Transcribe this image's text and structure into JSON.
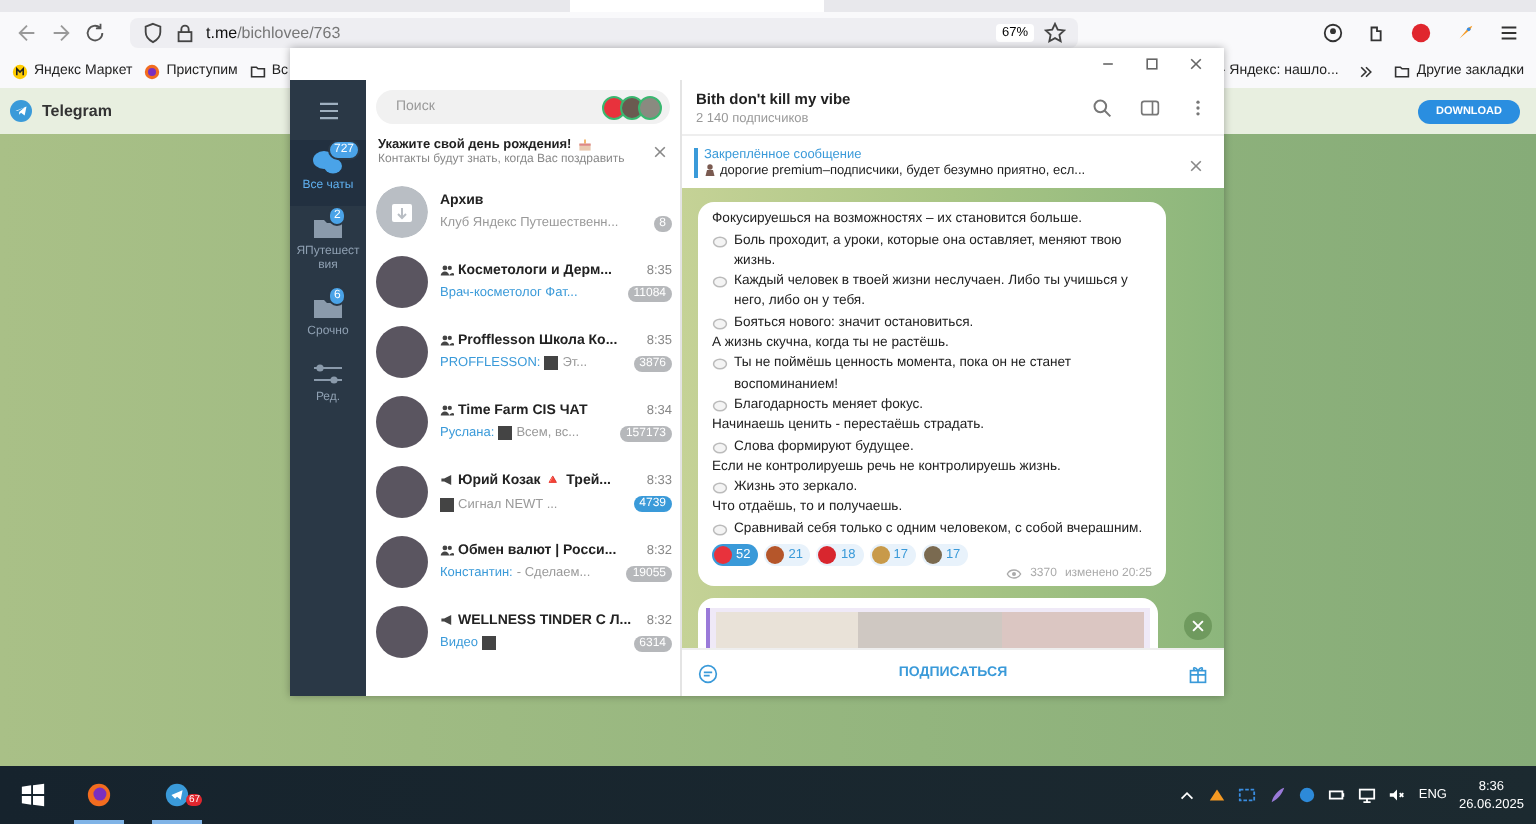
{
  "browser": {
    "url_host": "t.me",
    "url_path": "/bichlovee/763",
    "zoom": "67%",
    "bookmarks_left": [
      {
        "label": "Яндекс Маркет",
        "kind": "market"
      },
      {
        "label": "Приступим",
        "kind": "fox"
      },
      {
        "label": "Вс",
        "kind": "folder"
      }
    ],
    "bookmarks_right": [
      {
        "label": "- Яндекс: нашло...",
        "kind": "plain"
      },
      {
        "label": "Другие закладки",
        "kind": "folder"
      }
    ]
  },
  "web_header": {
    "title": "Telegram",
    "button": "DOWNLOAD"
  },
  "sidebar": {
    "folders": [
      {
        "label": "Все чаты",
        "badge": "727",
        "selected": true,
        "kind": "chats"
      },
      {
        "label": "ЯПутешествия",
        "badge": "2",
        "selected": false,
        "kind": "folder"
      },
      {
        "label": "Срочно",
        "badge": "6",
        "selected": false,
        "kind": "folder"
      },
      {
        "label": "Ред.",
        "selected": false,
        "kind": "edit"
      }
    ]
  },
  "search": {
    "placeholder": "Поиск"
  },
  "banner": {
    "title": "Укажите свой день рождения!",
    "text": "Контакты будут знать, когда Вас поздравить"
  },
  "chats": [
    {
      "kind": "archive",
      "name": "Архив",
      "preview": "Клуб Яндекс Путешественн...",
      "badge": "8",
      "muted": true
    },
    {
      "kind": "group",
      "name": "Косметологи и Дерм...",
      "time": "8:35",
      "accent": "Врач-косметолог Фат...",
      "badge": "11084",
      "muted": true
    },
    {
      "kind": "group",
      "name": "Profflesson Школа Ко...",
      "time": "8:35",
      "accent": "PROFFLESSON:",
      "media": true,
      "preview": "Эт...",
      "badge": "3876",
      "muted": true
    },
    {
      "kind": "group",
      "name": "Time Farm CIS ЧАТ",
      "time": "8:34",
      "accent": "Руслана:",
      "media": true,
      "preview": "Всем, вс...",
      "badge": "157173",
      "muted": true
    },
    {
      "kind": "channel",
      "name": "Юрий Козак 🔺 Трей...",
      "time": "8:33",
      "media": true,
      "preview": "Сигнал NEWT ...",
      "badge": "4739",
      "muted": false
    },
    {
      "kind": "group",
      "name": "Обмен валют | Росси...",
      "time": "8:32",
      "accent": "Константин:",
      "preview": "- Сделаем...",
      "badge": "19055",
      "muted": true
    },
    {
      "kind": "channel",
      "name": "WELLNESS TINDER С Л...",
      "time": "8:32",
      "media": true,
      "accent": "Видео",
      "badge": "6314",
      "muted": true
    }
  ],
  "chat": {
    "title": "Bith don't kill my vibe",
    "subtitle": "2 140 подписчиков",
    "pinned": {
      "title": "Закреплённое сообщение",
      "text": "дорогие premium–подписчики, будет безумно приятно, есл..."
    },
    "lines": [
      {
        "kind": "plain",
        "text": "Фокусируешься на возможностях – их становится больше."
      },
      {
        "kind": "bullet",
        "text": "Боль проходит, а уроки, которые она оставляет, меняют твою жизнь."
      },
      {
        "kind": "bullet",
        "text": "Каждый человек в твоей жизни неслучаен. Либо ты учишься у него, либо он у тебя."
      },
      {
        "kind": "bullet",
        "text": "Бояться нового: значит остановиться."
      },
      {
        "kind": "plain",
        "text": "А жизнь скучна, когда ты не растёшь."
      },
      {
        "kind": "bullet",
        "text": "Ты не поймёшь ценность момента, пока он не станет воспоминанием!"
      },
      {
        "kind": "bullet",
        "text": "Благодарность меняет фокус."
      },
      {
        "kind": "plain",
        "text": "Начинаешь ценить - перестаёшь страдать."
      },
      {
        "kind": "bullet",
        "text": "Слова формируют будущее."
      },
      {
        "kind": "plain",
        "text": "Если не контролируешь речь не контролируешь жизнь."
      },
      {
        "kind": "bullet",
        "text": "Жизнь это зеркало."
      },
      {
        "kind": "plain",
        "text": "Что отдаёшь, то и получаешь."
      },
      {
        "kind": "bullet",
        "text": "Сравнивай себя только с одним человеком, с собой вчерашним."
      }
    ],
    "reactions": [
      {
        "count": "52",
        "selected": true,
        "color": "#e8323c"
      },
      {
        "count": "21",
        "selected": false,
        "color": "#b5562a"
      },
      {
        "count": "18",
        "selected": false,
        "color": "#d8262e"
      },
      {
        "count": "17",
        "selected": false,
        "color": "#c89a4a"
      },
      {
        "count": "17",
        "selected": false,
        "color": "#7a6a50"
      }
    ],
    "views": "3370",
    "edited": "изменено 20:25",
    "subscribe": "ПОДПИСАТЬСЯ"
  },
  "taskbar": {
    "telegram_badge": "67",
    "lang": "ENG",
    "time": "8:36",
    "date": "26.06.2025"
  }
}
